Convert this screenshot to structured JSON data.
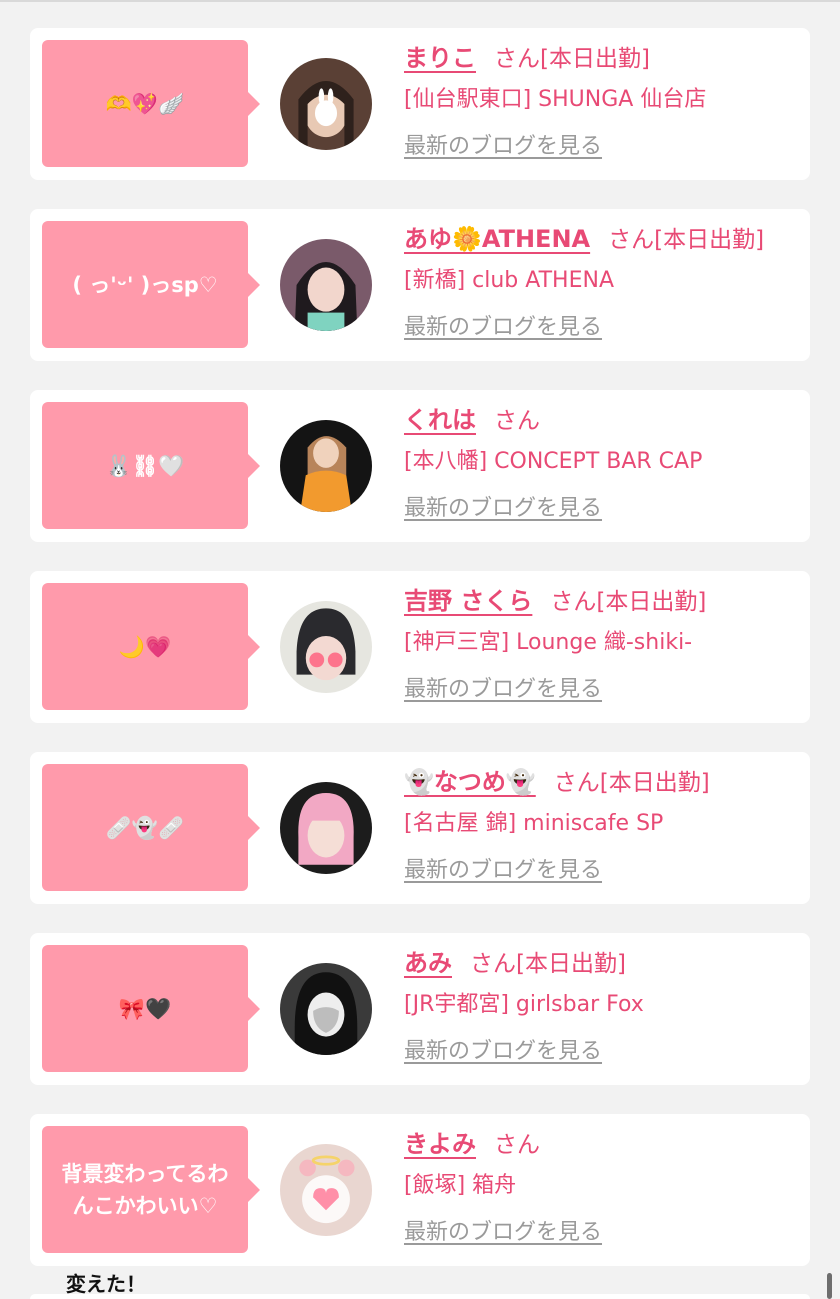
{
  "footer_text": "変えた！",
  "colors": {
    "accent": "#e84a75",
    "bubble": "#ff9aab",
    "page_background": "#f2f2f2",
    "link_gray": "#9a9a9a"
  },
  "cards": [
    {
      "message": "🫶💖🪽",
      "name": "まりこ",
      "suffix": "さん",
      "status": "[本日出勤]",
      "shop": "[仙台駅東口] SHUNGA 仙台店",
      "blog_link": "最新のブログを見る"
    },
    {
      "message": "( っ'ᵕ' )っsp♡",
      "name": "あゆ🌼ATHENA",
      "suffix": "さん",
      "status": "[本日出勤]",
      "shop": "[新橋] club ATHENA",
      "blog_link": "最新のブログを見る"
    },
    {
      "message": "🐰⛓🤍",
      "name": "くれは",
      "suffix": "さん",
      "status": "",
      "shop": "[本八幡] CONCEPT BAR CAP",
      "blog_link": "最新のブログを見る"
    },
    {
      "message": "🌙💗",
      "name": "吉野 さくら",
      "suffix": "さん",
      "status": "[本日出勤]",
      "shop": "[神戸三宮] Lounge 織-shiki-",
      "blog_link": "最新のブログを見る"
    },
    {
      "message": "🩹👻🩹",
      "name": "👻なつめ👻",
      "suffix": "さん",
      "status": "[本日出勤]",
      "shop": "[名古屋 錦] miniscafe SP",
      "blog_link": "最新のブログを見る"
    },
    {
      "message": "🎀🖤",
      "name": "あみ",
      "suffix": "さん",
      "status": "[本日出勤]",
      "shop": "[JR宇都宮] girlsbar Fox",
      "blog_link": "最新のブログを見る"
    },
    {
      "message": "背景変わってるわ\nんこかわいい♡",
      "name": "きよみ",
      "suffix": "さん",
      "status": "",
      "shop": "[飯塚] 箱舟",
      "blog_link": "最新のブログを見る"
    }
  ]
}
